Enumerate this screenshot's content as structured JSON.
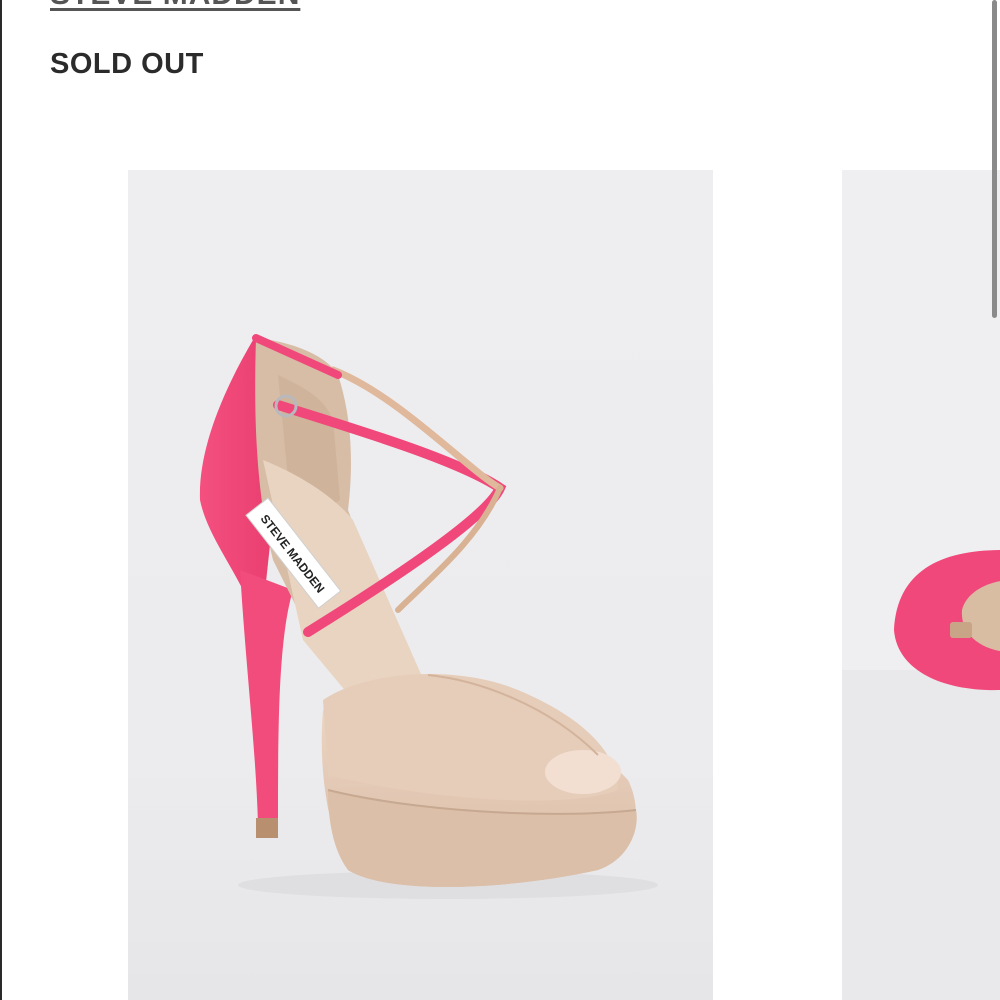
{
  "product": {
    "brand": "STEVE MADDEN",
    "status": "SOLD OUT"
  },
  "images": [
    {
      "id": "main",
      "shoe_label": "STEVE MADDEN",
      "description_icon": "pink-nude-platform-sandal"
    },
    {
      "id": "next",
      "description_icon": "pink-shoe-partial"
    }
  ],
  "colors": {
    "background": "#ffffff",
    "photo_background": "#eeeef0",
    "strap_pink": "#f0487a",
    "nude": "#e4cbb7"
  }
}
